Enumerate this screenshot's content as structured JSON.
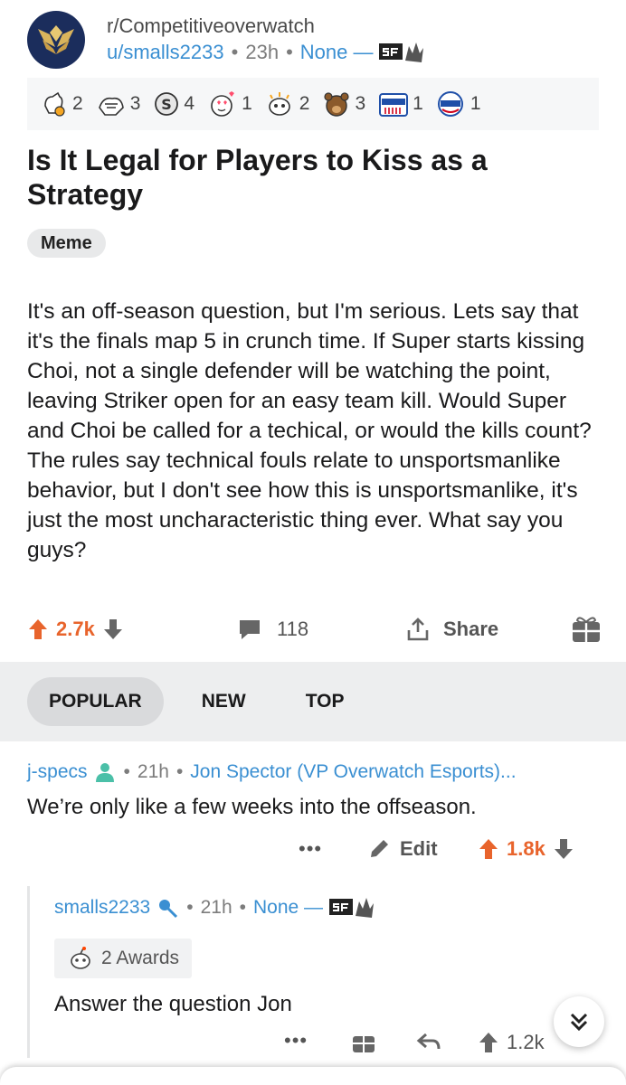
{
  "post": {
    "subreddit": "r/Competitiveoverwatch",
    "author": "u/smalls2233",
    "age": "23h",
    "flair_text": "None —",
    "awards": [
      {
        "icon": "helpful-hand-icon",
        "count": "2"
      },
      {
        "icon": "wholesome-icon",
        "count": "3"
      },
      {
        "icon": "silver-s-icon",
        "count": "4"
      },
      {
        "icon": "heart-eyes-icon",
        "count": "1"
      },
      {
        "icon": "snoo-gold-icon",
        "count": "2"
      },
      {
        "icon": "bear-icon",
        "count": "3"
      },
      {
        "icon": "voted-icon",
        "count": "1"
      },
      {
        "icon": "vote-icon",
        "count": "1"
      }
    ],
    "title": "Is It Legal for Players to Kiss as a Strategy",
    "flair": "Meme",
    "body": "It's an off-season question, but I'm serious. Lets say that it's the finals map 5 in crunch time. If Super starts kissing Choi, not a single defender will be watching the point, leaving Striker open for an easy team kill. Would Super and Choi be called for a techical, or would the kills count? The rules say technical fouls relate to unsportsmanlike behavior, but I don't see how this is unsportsmanlike, it's just the most uncharacteristic thing ever. What say you guys?",
    "score": "2.7k",
    "comments": "118",
    "share_label": "Share"
  },
  "sort": {
    "tabs": [
      "POPULAR",
      "NEW",
      "TOP"
    ],
    "active": "POPULAR"
  },
  "comment1": {
    "user": "j-specs",
    "age": "21h",
    "flair": "Jon Spector (VP Overwatch Esports)...",
    "text": "We’re only like a few weeks into the offseason.",
    "more": "•••",
    "edit_label": "Edit",
    "score": "1.8k"
  },
  "comment2": {
    "user": "smalls2233",
    "age": "21h",
    "flair_text": "None —",
    "awards_label": "2 Awards",
    "text": "Answer the question Jon",
    "more": "•••",
    "score": "1.2k"
  },
  "colors": {
    "upvote": "#e8642c",
    "link": "#3a8fd2",
    "subreddit_icon": "#1b2d5c"
  }
}
